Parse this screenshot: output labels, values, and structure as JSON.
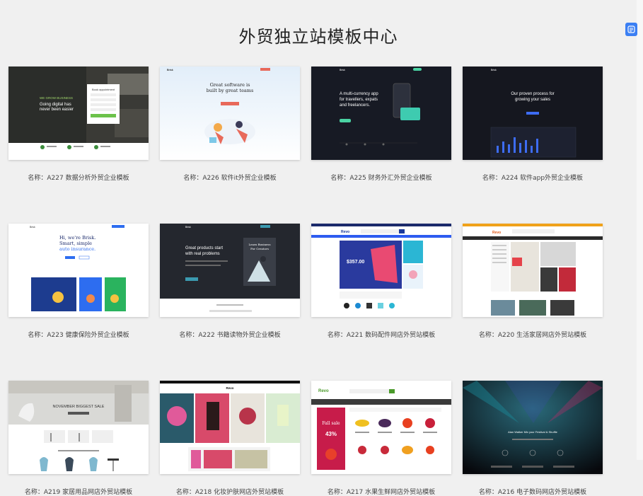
{
  "page": {
    "title": "外贸独立站模板中心"
  },
  "templates": [
    {
      "caption": "名称：A227 数据分析外贸企业模板",
      "preview": {
        "line1": "Going digital has",
        "line2": "never been easier",
        "form_title": "Book appointment"
      }
    },
    {
      "caption": "名称：A226 软件it外贸企业模板",
      "preview": {
        "brand": "Brisk",
        "line1": "Great software is",
        "line2": "built by great teams"
      }
    },
    {
      "caption": "名称：A225 财务外汇外贸企业模板",
      "preview": {
        "brand": "Brisk",
        "line1": "A multi-currency app",
        "line2": "for travellers, expats",
        "line3": "and freelancers."
      }
    },
    {
      "caption": "名称：A224 软件app外贸企业模板",
      "preview": {
        "brand": "Brisk",
        "line1": "Our proven process for",
        "line2": "growing your sales"
      }
    },
    {
      "caption": "名称：A223 健康保险外贸企业模板",
      "preview": {
        "brand": "Brisk",
        "line1": "Hi, we're Brisk.",
        "line2": "Smart, simple",
        "line3": "auto insurance."
      }
    },
    {
      "caption": "名称：A222 书籍读物外贸企业模板",
      "preview": {
        "brand": "Brisk",
        "line1": "Great products start",
        "line2": "with real problems",
        "book1": "Learn Business",
        "book2": "For Creators"
      }
    },
    {
      "caption": "名称：A221 数码配件网店外贸站模板",
      "preview": {
        "brand": "Revo",
        "price": "$357.00"
      }
    },
    {
      "caption": "名称：A220 生活家居网店外贸站模板",
      "preview": {
        "brand": "Revo"
      }
    },
    {
      "caption": "名称：A219 家居用品网店外贸站模板",
      "preview": {
        "banner": "NOVEMBER BIGGEST SALE"
      }
    },
    {
      "caption": "名称：A218 化妆护肤网店外贸站模板",
      "preview": {
        "brand": "Revo"
      }
    },
    {
      "caption": "名称：A217 水果生鲜网店外贸站模板",
      "preview": {
        "brand": "Revo",
        "promo": "Fall sale",
        "percent": "43%"
      }
    },
    {
      "caption": "名称：A216 电子数码网店外贸站模板",
      "preview": {
        "headline": "Alan Walker Mix your Festival & Shuffle"
      }
    }
  ]
}
